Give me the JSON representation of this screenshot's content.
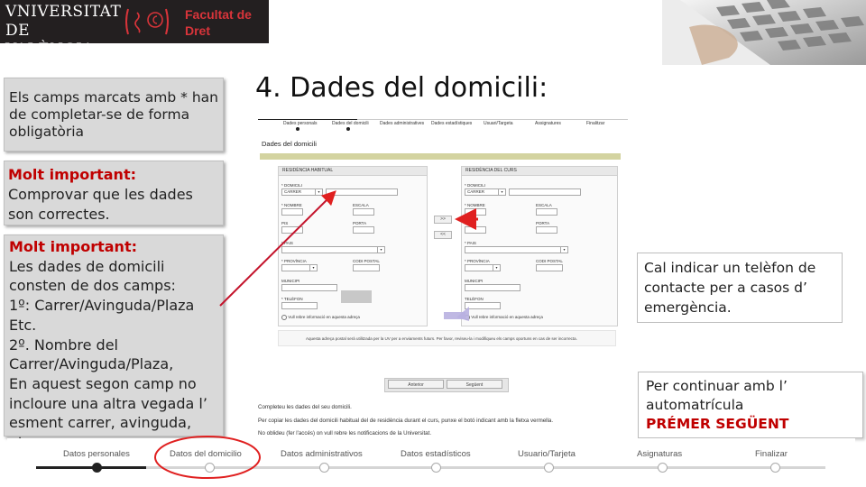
{
  "header": {
    "university_lines": [
      "VNIVERSITAT",
      "DE VALÈNCIA"
    ],
    "faculty_lines": [
      "Facultat de",
      "Dret"
    ]
  },
  "slide": {
    "title": "4. Dades del domicili:"
  },
  "left_boxes": {
    "required_note": "Els camps marcats amb * han de completar-se de forma obligatòria",
    "important_1_heading": "Molt important:",
    "important_1_text": "Comprovar que les dades son correctes.",
    "important_2_heading": "Molt important:",
    "important_2_text": "Les dades de domicili consten de dos camps:\n1º: Carrer/Avinguda/Plaza Etc.\n2º. Nombre del Carrer/Avinguda/Plaza,\nEn aquest segon camp no incloure una altra vegada l’ esment carrer, avinguda, etc."
  },
  "right_notes": {
    "phone_note": "Cal indicar un telèfon de contacte per a casos d’ emergència.",
    "continue_text": "Per continuar amb l’ automatrícula",
    "continue_action": "PRÉMER  SEGÜENT"
  },
  "form_screenshot": {
    "top_steps": [
      "Dades personals",
      "Dades del domicili",
      "Dades administratives",
      "Dades estadístiques",
      "Usuari/Targeta",
      "Assignatures",
      "Finalitzar"
    ],
    "section_title": "Dades del domicili",
    "left_panel": {
      "title": "RESIDÈNCIA HABITUAL",
      "domicili_label": "* DOMICILI",
      "domicili_value": "CARRER",
      "nombre_label": "* NOMBRE",
      "escala_label": "ESCALA",
      "pis_label": "PIS",
      "porta_label": "PORTA",
      "pais_label": "* PAIS",
      "provincia_label": "* PROVÍNCIA",
      "cp_label": "CODI POSTAL",
      "municipi_label": "MUNICIPI",
      "telefon_label": "* TELÈFON",
      "checkbox_label": "Vull rebre informació en aquesta adreça"
    },
    "right_panel": {
      "title": "RESIDÈNCIA DEL CURS",
      "domicili_label": "* DOMICILI",
      "domicili_value": "CARRER",
      "nombre_label": "* NOMBRE",
      "escala_label": "ESCALA",
      "pis_label": "PIS",
      "porta_label": "PORTA",
      "pais_label": "* PAIS",
      "provincia_label": "* PROVÍNCIA",
      "cp_label": "CODI POSTAL",
      "municipi_label": "MUNICIPI",
      "telefon_label": "TELÈFON",
      "checkbox_label": "Vull rebre informació en aquesta adreça"
    },
    "copy_right_label": ">>",
    "copy_left_label": "<<",
    "notice": "Aquesta adreça postal serà utilitzada per la UV per a enviaments futurs. Per favor, reviseu-la i modifiqueu els camps oportuns en cas de ser incorrecta.",
    "back_button": "Anterior",
    "next_button": "Següent",
    "help_lines": [
      "Completeu les dades del seu domicili.",
      "Per copiar les dades del domicili habitual del de residència durant el curs, punxe el botó indicant amb la fletxa vermella.",
      "No oblideu (fer l'accés) on vull rebre les notificacions de la Universitat."
    ]
  },
  "step_bar": {
    "steps": [
      "Datos personales",
      "Datos del domicilio",
      "Datos administrativos",
      "Datos estadísticos",
      "Usuario/Tarjeta",
      "Asignaturas",
      "Finalizar"
    ],
    "current_index": 1
  },
  "colors": {
    "logo_bg": "#231f20",
    "faculty_red": "#d8343a",
    "important_red": "#c00000",
    "box_gray": "#d9d9d9",
    "annotation_red": "#e02020"
  }
}
